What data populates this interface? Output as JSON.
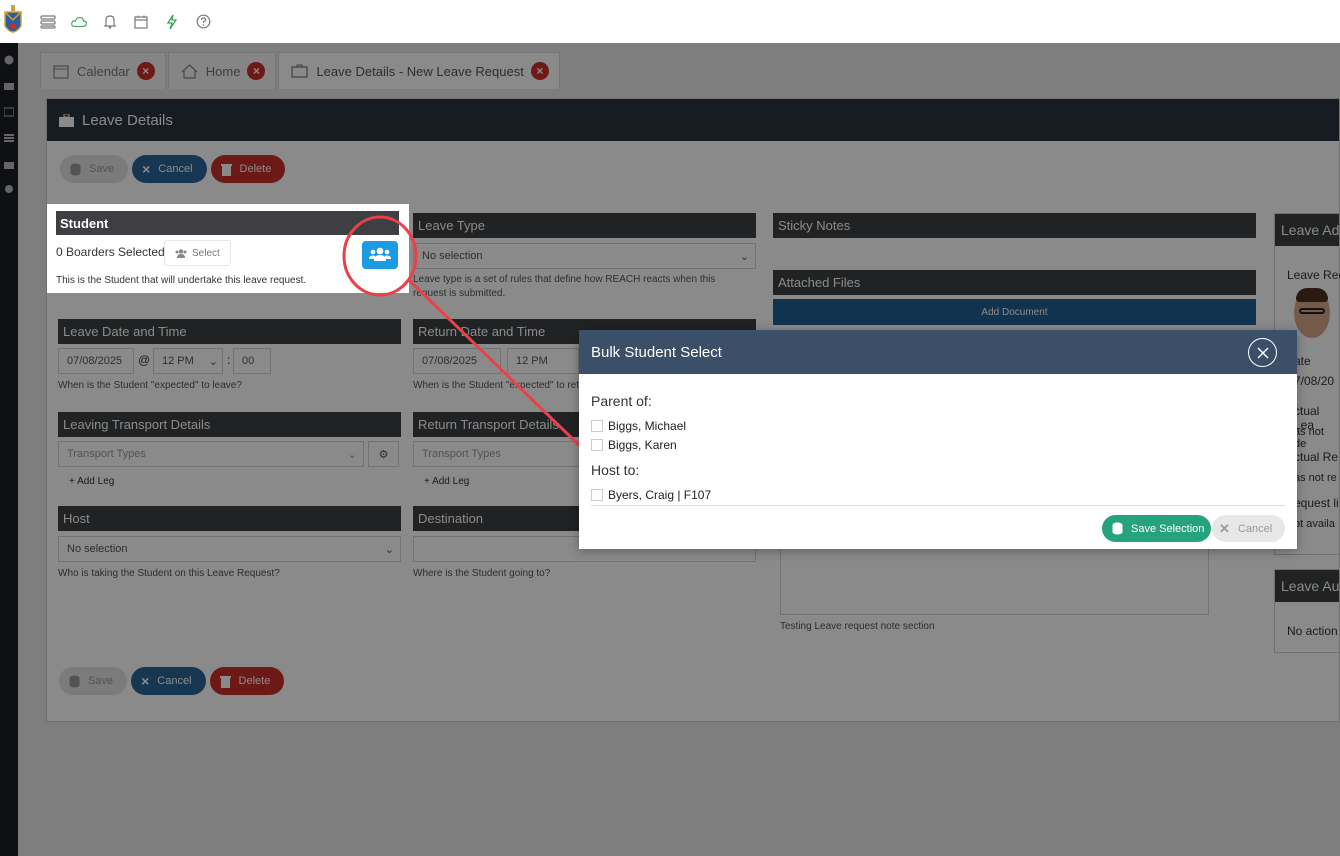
{
  "tabs": [
    {
      "label": "Calendar"
    },
    {
      "label": "Home"
    },
    {
      "label": "Leave Details - New Leave Request"
    }
  ],
  "panel": {
    "title": "Leave Details",
    "save_label": "Save",
    "cancel_label": "Cancel",
    "delete_label": "Delete"
  },
  "student": {
    "header": "Student",
    "count_text": "0 Boarders Selected",
    "select_label": "Select",
    "hint": "This is the Student that will undertake this leave request."
  },
  "leave_type": {
    "header": "Leave Type",
    "value": "No selection",
    "hint_line1": "Leave type is a set of rules that define how REACH reacts when this",
    "hint_line2": "request is submitted."
  },
  "sticky_notes": {
    "header": "Sticky Notes"
  },
  "attached_files": {
    "header": "Attached Files",
    "add_label": "Add Document"
  },
  "leave_date": {
    "header": "Leave Date and Time",
    "date": "07/08/2025",
    "at": "@",
    "hour": "12 PM",
    "colon": ":",
    "minute": "00",
    "hint": "When is the Student \"expected\" to leave?"
  },
  "return_date": {
    "header": "Return Date and Time",
    "date": "07/08/2025",
    "hour": "12 PM",
    "hint": "When is the Student \"expected\" to return?"
  },
  "leaving_transport": {
    "header": "Leaving Transport Details",
    "placeholder": "Transport Types",
    "add_leg": "+ Add Leg"
  },
  "return_transport": {
    "header": "Return Transport Details",
    "placeholder": "Transport Types",
    "add_leg": "+ Add Leg"
  },
  "host": {
    "header": "Host",
    "value": "No selection",
    "hint": "Who is taking the Student on this Leave Request?"
  },
  "destination": {
    "header": "Destination",
    "hint": "Where is the Student going to?"
  },
  "notes_hint": "Testing Leave request note section",
  "right_panel": {
    "header1": "Leave Ad",
    "line1": "Leave Rec",
    "line2": "ate",
    "line3": "7/08/20",
    "line4": "ctual Lea",
    "line5": "as not de",
    "line6": "ctual Re",
    "line7": "as not re",
    "line8": "equest li",
    "line9": "ot availa",
    "header2": "Leave Au",
    "line10": "No action"
  },
  "modal": {
    "title": "Bulk Student Select",
    "parent_label": "Parent of:",
    "parents": [
      "Biggs, Michael",
      "Biggs, Karen"
    ],
    "host_label": "Host to:",
    "hosts": [
      "Byers, Craig | F107"
    ],
    "save_label": "Save Selection",
    "cancel_label": "Cancel"
  },
  "colors": {
    "header_dark": "#2b3441",
    "modal_header": "#3b5068",
    "save_green": "#26a37e",
    "annotation_red": "#e8414a",
    "group_button_blue": "#1b9ce2"
  }
}
